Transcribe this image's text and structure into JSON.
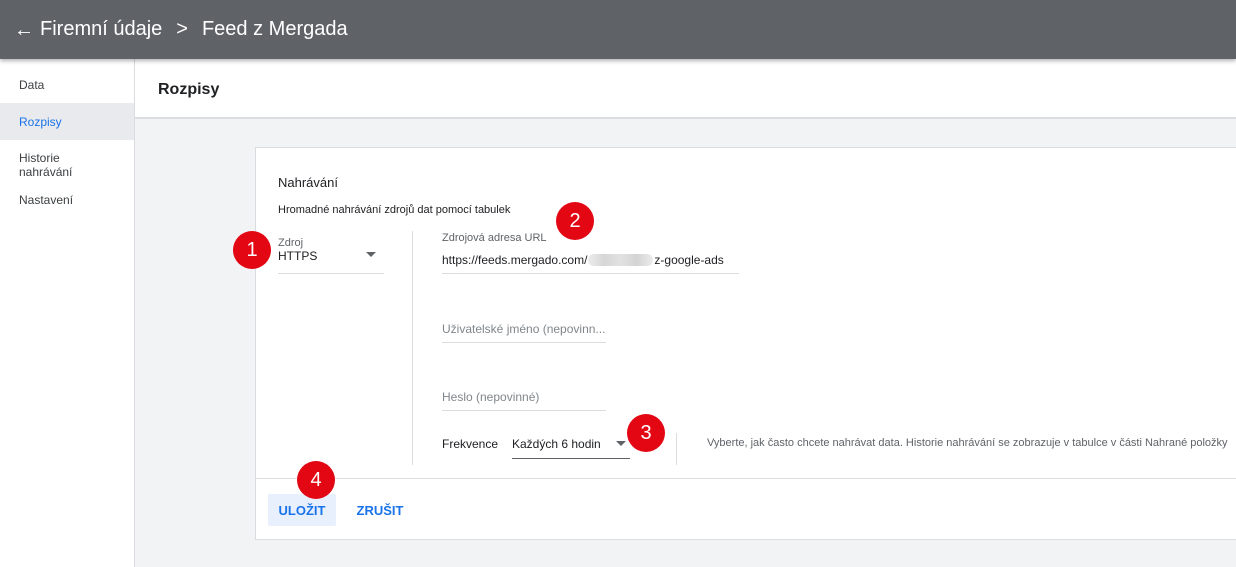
{
  "topbar": {
    "back_icon": "arrow-back-icon",
    "breadcrumb_parent": "Firemní údaje",
    "breadcrumb_sep": ">",
    "breadcrumb_current": "Feed z Mergada"
  },
  "sidebar": {
    "items": [
      {
        "label": "Data"
      },
      {
        "label": "Rozpisy",
        "active": true
      },
      {
        "label": "Historie nahrávání"
      },
      {
        "label": "Nastavení"
      }
    ]
  },
  "page": {
    "title": "Rozpisy"
  },
  "upload": {
    "section_title": "Nahrávání",
    "section_description": "Hromadné nahrávání zdrojů dat pomocí tabulek",
    "source_label": "Zdroj",
    "source_value": "HTTPS",
    "url_label": "Zdrojová adresa URL",
    "url_value_prefix": "https://feeds.mergado.com/",
    "url_value_suffix": "z-google-ads",
    "username_placeholder": "Uživatelské jméno (nepovinn...",
    "password_placeholder": "Heslo (nepovinné)",
    "frequency_label": "Frekvence",
    "frequency_value": "Každých 6 hodin",
    "frequency_help": "Vyberte, jak často chcete nahrávat data. Historie nahrávání se zobrazuje v tabulce v části Nahrané položky"
  },
  "actions": {
    "save_label": "ULOŽIT",
    "cancel_label": "ZRUŠIT"
  },
  "markers": [
    "1",
    "2",
    "3",
    "4"
  ],
  "colors": {
    "topbar": "#5f6368",
    "accent": "#1a73e8",
    "marker": "#e30613"
  }
}
